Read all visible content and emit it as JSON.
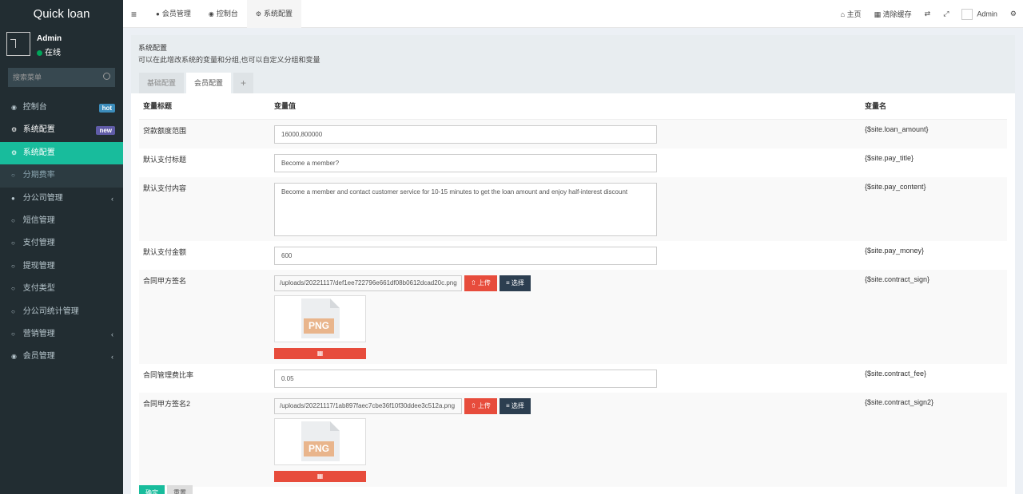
{
  "app": {
    "title": "Quick loan"
  },
  "user": {
    "name": "Admin",
    "status": "在线"
  },
  "search": {
    "placeholder": "搜索菜单"
  },
  "menu": [
    {
      "label": "控制台",
      "icon": "dashboard-icon",
      "badge": "hot"
    },
    {
      "label": "系统配置",
      "icon": "gears-icon",
      "badge": "new"
    },
    {
      "label": "系统配置",
      "icon": "gear-icon"
    },
    {
      "label": "分期费率",
      "icon": "circle-icon"
    },
    {
      "label": "分公司管理",
      "icon": "users-icon",
      "chevron": "‹"
    },
    {
      "label": "短信管理",
      "icon": "circle-icon"
    },
    {
      "label": "支付管理",
      "icon": "circle-icon"
    },
    {
      "label": "提现管理",
      "icon": "circle-icon"
    },
    {
      "label": "支付类型",
      "icon": "circle-icon"
    },
    {
      "label": "分公司统计管理",
      "icon": "circle-icon"
    },
    {
      "label": "营销管理",
      "icon": "circle-icon",
      "chevron": "‹"
    },
    {
      "label": "会员管理",
      "icon": "user-circle-icon",
      "chevron": "‹"
    }
  ],
  "topbar": {
    "tabs": [
      {
        "label": "会员管理"
      },
      {
        "label": "控制台"
      },
      {
        "label": "系统配置"
      }
    ],
    "right": {
      "home": "主页",
      "clear_cache": "清除缓存",
      "admin": "Admin"
    }
  },
  "panel": {
    "title": "系统配置",
    "desc": "可以在此增改系统的变量和分组,也可以自定义分组和变量",
    "tabs": [
      "基础配置",
      "会员配置",
      "+"
    ]
  },
  "table": {
    "headers": [
      "变量标题",
      "变量值",
      "变量名"
    ],
    "rows": [
      {
        "title": "贷款额度范围",
        "value": "16000,800000",
        "name": "{$site.loan_amount}"
      },
      {
        "title": "默认支付标题",
        "value": "Become a member?",
        "name": "{$site.pay_title}"
      },
      {
        "title": "默认支付内容",
        "value": "Become a member and contact customer service for 10-15 minutes to get the loan amount and enjoy half-interest discount",
        "name": "{$site.pay_content}"
      },
      {
        "title": "默认支付金额",
        "value": "600",
        "name": "{$site.pay_money}"
      },
      {
        "title": "合同甲方签名",
        "value": "/uploads/20221117/def1ee722796e661df08b0612dcad20c.png",
        "name": "{$site.contract_sign}"
      },
      {
        "title": "合同管理费比率",
        "value": "0.05",
        "name": "{$site.contract_fee}"
      },
      {
        "title": "合同甲方签名2",
        "value": "/uploads/20221117/1ab897faec7cbe36f10f30ddee3c512a.png",
        "name": "{$site.contract_sign2}"
      }
    ],
    "upload_label": "上传",
    "choose_label": "选择",
    "thumb_label": "PNG"
  },
  "buttons": {
    "confirm": "确定",
    "reset": "重置"
  }
}
